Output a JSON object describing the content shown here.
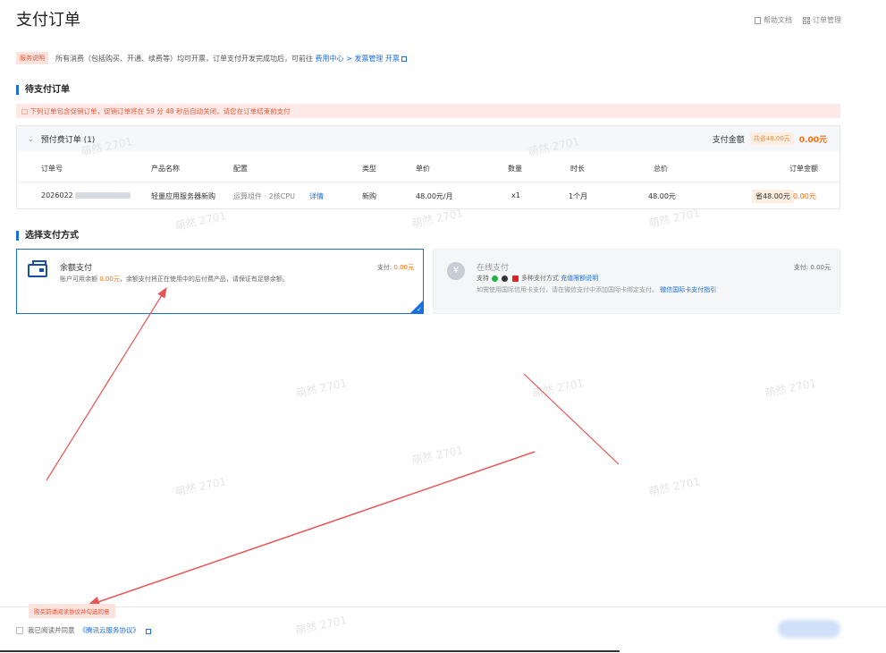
{
  "header": {
    "title": "支付订单",
    "links": [
      "帮助文档",
      "订单管理"
    ]
  },
  "notice": {
    "tag": "服务说明",
    "text": "所有消费（包括购买、开通、续费等）均可开票，订单支付开发完成功后，可前往",
    "link1": "费用中心 > 发票管理 开票"
  },
  "pending": {
    "title": "待支付订单",
    "warning": "□ 下列订单包含促销订单，促销订单将在 59 分 48 秒后自动关闭，请您在订单结束前支付",
    "group": {
      "label": "预付费订单 (1)",
      "total_label": "支付金额",
      "total_badge": "共省48.00元",
      "total_value": "0.00元"
    },
    "columns": [
      "订单号",
      "产品名称",
      "配置",
      "类型",
      "单价",
      "数量",
      "时长",
      "总价",
      "订单金额"
    ],
    "row": {
      "order_no": "2026022",
      "product": "轻量应用服务器新购",
      "config": "运算组件 · 2核CPU",
      "detail": "详情",
      "type": "新购",
      "unit_price": "48.00元/月",
      "qty": "x1",
      "duration": "1个月",
      "total": "48.00元",
      "discount": "省48.00元",
      "amount": "0.00元"
    }
  },
  "payment": {
    "title": "选择支付方式",
    "balance": {
      "title": "余额支付",
      "desc_pre": "账户可用余额",
      "desc_amt": "0.00元",
      "desc_post": "，余额支付将正在使用中的后付费产品，请保证有足够余额。",
      "amt_label": "支付:",
      "amt_value": "0.00元"
    },
    "online": {
      "title": "在线支付",
      "support_pre": "支持",
      "support_post": "多种支付方式",
      "link1": "充值限额说明",
      "desc": "如需使用国际信用卡支付，请在微信支付中添加国际卡绑定支付。",
      "link2": "微信国际卡支付指引",
      "amt_label": "支付:",
      "amt_value": "0.00元"
    }
  },
  "footer": {
    "tip": "购买前请阅读协议并勾选同意",
    "agree_text": "我已阅读并同意",
    "agree_link": "《腾讯云服务协议》"
  },
  "watermark": "萌然 2701",
  "colors": {
    "accent": "#1a6fe0",
    "warn": "#e85a3c",
    "orange": "#ff6a00",
    "annotation": "#e85555"
  }
}
